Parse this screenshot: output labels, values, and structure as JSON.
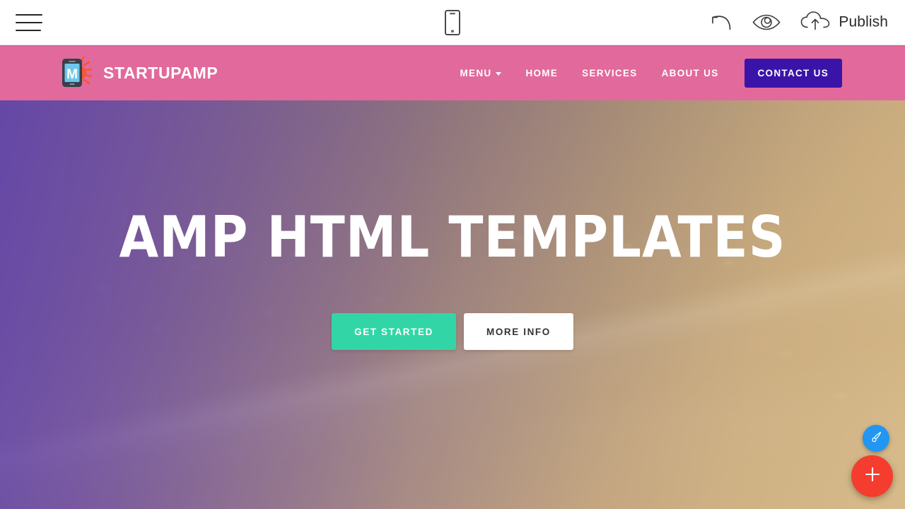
{
  "editor": {
    "menu_icon": "hamburger-menu-icon",
    "device_preview": {
      "icon": "mobile-device-icon",
      "label": "Mobile"
    },
    "undo": {
      "icon": "undo-arrow-icon",
      "label": "Undo"
    },
    "preview": {
      "icon": "eye-icon",
      "label": "Preview"
    },
    "publish": {
      "icon": "cloud-upload-icon",
      "label": "Publish"
    }
  },
  "site": {
    "brand": {
      "name": "STARTUPAMP",
      "logo_icon": "phone-sun-logo-icon",
      "logo_letter": "M"
    },
    "nav": [
      {
        "label": "MENU",
        "has_dropdown": true
      },
      {
        "label": "HOME",
        "has_dropdown": false
      },
      {
        "label": "SERVICES",
        "has_dropdown": false
      },
      {
        "label": "ABOUT US",
        "has_dropdown": false
      }
    ],
    "cta_button": "CONTACT US",
    "navbar_color": "#e2699b",
    "cta_color": "#3a14a8"
  },
  "hero": {
    "title": "AMP HTML TEMPLATES",
    "primary_button": "GET STARTED",
    "secondary_button": "MORE INFO",
    "primary_color": "#32d6a6",
    "secondary_color": "#ffffff",
    "overlay_start": "#6849b2",
    "overlay_end": "#d6b87b"
  },
  "fabs": {
    "style_editor": {
      "icon": "paint-brush-icon",
      "color": "#2196f3"
    },
    "add_block": {
      "icon": "plus-icon",
      "color": "#f43d2e"
    }
  }
}
